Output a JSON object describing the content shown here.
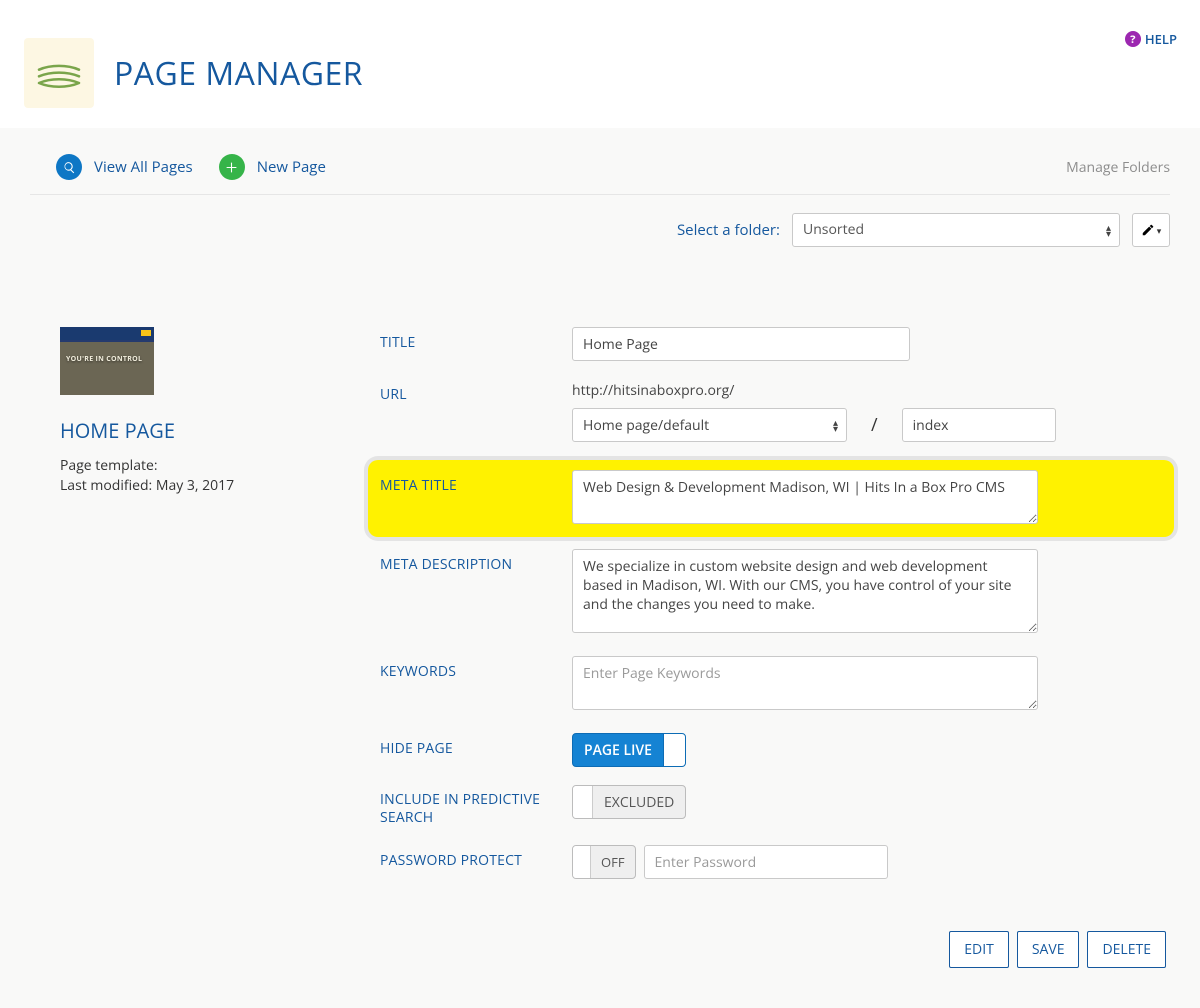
{
  "help": {
    "label": "HELP"
  },
  "header": {
    "title": "PAGE MANAGER"
  },
  "toolbar": {
    "view_all": "View All Pages",
    "new_page": "New Page",
    "manage_folders": "Manage Folders"
  },
  "folder": {
    "label": "Select a folder:",
    "selected": "Unsorted"
  },
  "leftcol": {
    "thumb_text": "YOU'RE IN CONTROL",
    "page_name": "HOME PAGE",
    "tmpl_label": "Page template:",
    "modified": "Last modified: May 3, 2017"
  },
  "fields": {
    "title_label": "TITLE",
    "title_value": "Home Page",
    "url_label": "URL",
    "url_base": "http://hitsinaboxpro.org/",
    "url_select": "Home page/default",
    "url_slash": "/",
    "url_slug": "index",
    "meta_title_label": "META TITLE",
    "meta_title_value": "Web Design & Development Madison, WI | Hits In a Box Pro CMS",
    "meta_desc_label": "META DESCRIPTION",
    "meta_desc_value": "We specialize in custom website design and web development based in Madison, WI. With our CMS, you have control of your site and the changes you need to make.",
    "keywords_label": "KEYWORDS",
    "keywords_placeholder": "Enter Page Keywords",
    "hide_label": "HIDE PAGE",
    "hide_toggle": "PAGE LIVE",
    "predictive_label": "INCLUDE IN PREDICTIVE SEARCH",
    "predictive_toggle": "EXCLUDED",
    "pw_label": "PASSWORD PROTECT",
    "pw_toggle": "OFF",
    "pw_placeholder": "Enter Password"
  },
  "actions": {
    "edit": "EDIT",
    "save": "SAVE",
    "delete": "DELETE"
  }
}
